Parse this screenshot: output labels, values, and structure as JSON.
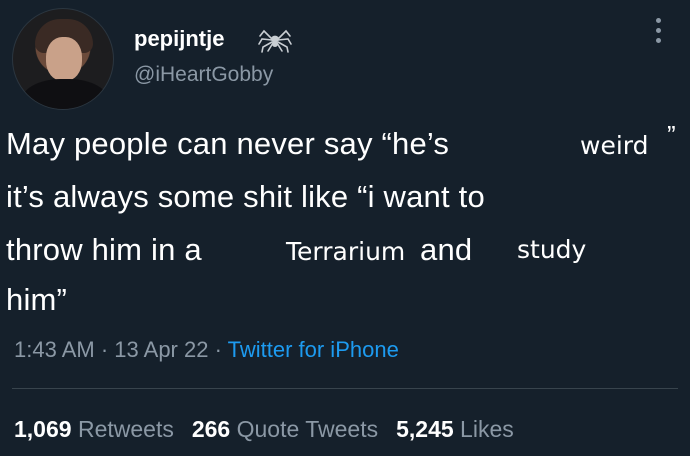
{
  "author": {
    "display_name": "pepijntje",
    "handle": "@iHeartGobby",
    "avatar_icon": "profile-photo",
    "badge_icon": "spider-icon"
  },
  "tweet": {
    "line1": "May people can never say “he’s",
    "line1_insert": "weird",
    "line1_close": "”",
    "line2": "it’s always some shit like “i want to",
    "line3_a": "throw him in a",
    "line3_insert1": "Terrarium",
    "line3_b": "and",
    "line3_insert2": "study",
    "line4": "him”"
  },
  "meta": {
    "time": "1:43 AM",
    "sep1": " · ",
    "date": "13 Apr 22",
    "sep2": " · ",
    "source": "Twitter for iPhone"
  },
  "stats": {
    "retweets_count": "1,069",
    "retweets_label": "Retweets",
    "quotes_count": "266",
    "quotes_label": "Quote Tweets",
    "likes_count": "5,245",
    "likes_label": "Likes"
  },
  "colors": {
    "background": "#15202b",
    "secondary_text": "#8b98a5",
    "link": "#1d9bf0"
  }
}
